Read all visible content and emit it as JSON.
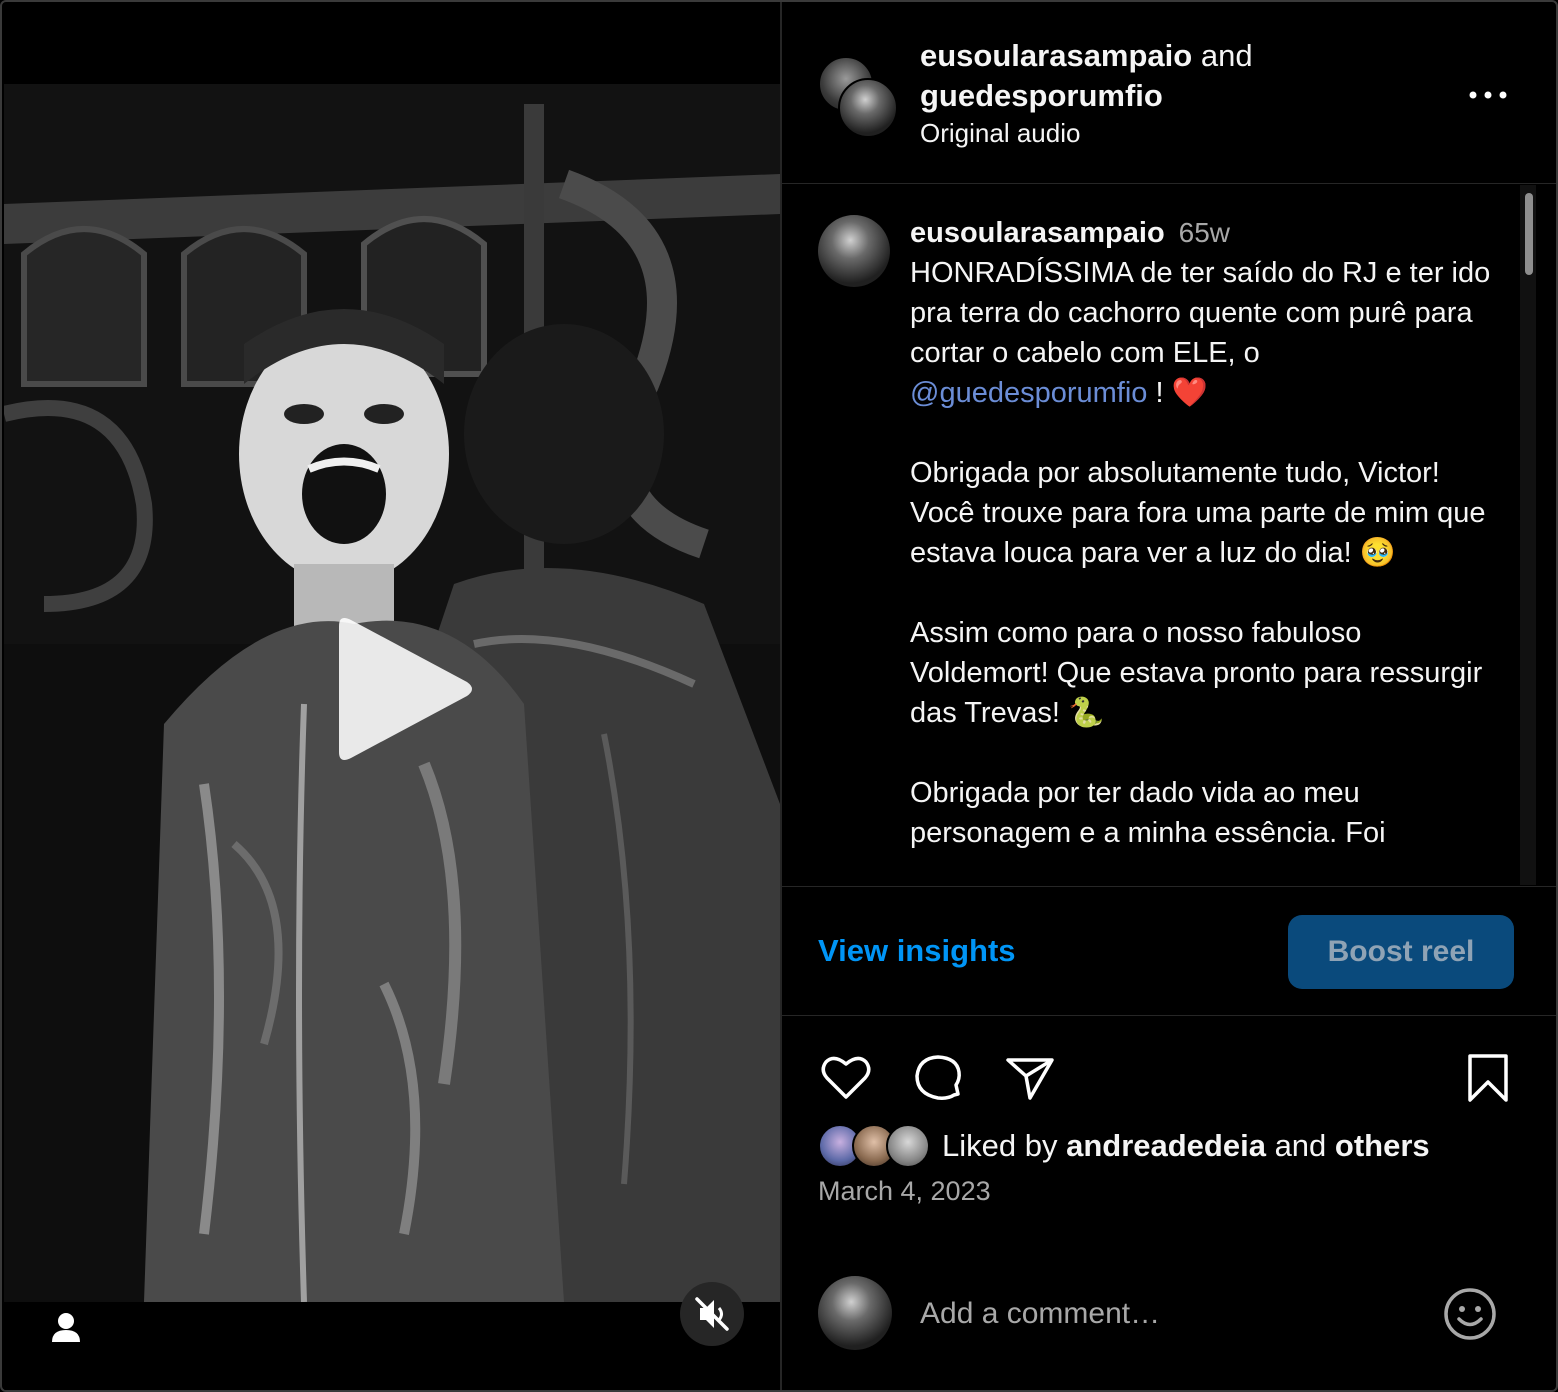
{
  "header": {
    "user1": "eusoularasampaio",
    "conjunction": "and",
    "user2": "guedesporumfio",
    "audio": "Original audio"
  },
  "caption": {
    "username": "eusoularasampaio",
    "time": "65w",
    "p1_before": "HONRADÍSSIMA de ter saído do RJ e ter ido pra terra do cachorro quente com purê para cortar o cabelo com ELE, o ",
    "p1_mention": "@guedesporumfio",
    "p1_after": " ! ❤️",
    "p2": "Obrigada por absolutamente tudo, Victor! Você trouxe para fora uma parte de mim que estava louca para ver a luz do dia! 🥹",
    "p3": "Assim como para o nosso fabuloso Voldemort! Que estava pronto para ressurgir das Trevas! 🐍",
    "p4": "Obrigada por ter dado vida ao meu personagem e a minha essência. Foi"
  },
  "actions": {
    "insights": "View insights",
    "boost": "Boost reel"
  },
  "icons": [
    "heart-icon",
    "comment-icon",
    "share-icon",
    "bookmark-icon",
    "more-icon",
    "play-icon",
    "muted-icon",
    "user-tag-icon",
    "emoji-icon"
  ],
  "likes": {
    "prefix": "Liked by ",
    "user": "andreadedeia",
    "middle": " and ",
    "others": "others"
  },
  "date": "March 4, 2023",
  "comment": {
    "placeholder": "Add a comment…"
  },
  "colors": {
    "link": "#0095f6",
    "mention": "#6b8dd6",
    "boost_bg": "#0a4a7c",
    "muted_text": "#a8a8a8",
    "like_heart": "#e0245e"
  }
}
